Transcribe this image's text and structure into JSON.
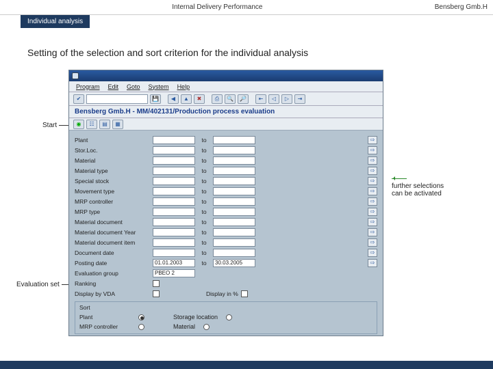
{
  "topbar": {
    "center": "Internal Delivery Performance",
    "right": "Bensberg Gmb.H"
  },
  "navtab": "Individual analysis",
  "section_title": "Setting of the selection and sort criterion for the individual analysis",
  "sap": {
    "menu": {
      "program": "Program",
      "edit": "Edit",
      "goto": "Goto",
      "system": "System",
      "help": "Help"
    },
    "heading": "Bensberg Gmb.H - MM/402131/Production process evaluation",
    "rows": [
      {
        "label": "Plant",
        "to": "to"
      },
      {
        "label": "Stor.Loc.",
        "to": "to"
      },
      {
        "label": "Material",
        "to": "to"
      },
      {
        "label": "Material type",
        "to": "to"
      },
      {
        "label": "Special stock",
        "to": "to"
      },
      {
        "label": "Movement type",
        "to": "to"
      },
      {
        "label": "MRP controller",
        "to": "to"
      },
      {
        "label": "MRP type",
        "to": "to"
      },
      {
        "label": "Material document",
        "to": "to"
      },
      {
        "label": "Material document Year",
        "to": "to"
      },
      {
        "label": "Material document item",
        "to": "to"
      },
      {
        "label": "Document date",
        "to": "to"
      }
    ],
    "posting": {
      "label": "Posting date",
      "from": "01.01.2003",
      "to_lbl": "to",
      "to": "30.03.2005"
    },
    "evalgroup": {
      "label": "Evaluation group",
      "value": "PBEO 2"
    },
    "ranking": {
      "label": "Ranking"
    },
    "display_vda": {
      "label": "Display by VDA",
      "pct": "Display in %"
    },
    "sort": {
      "title": "Sort",
      "r1": {
        "a": "Plant",
        "b": "Storage location"
      },
      "r2": {
        "a": "MRP controller",
        "b": "Material"
      }
    }
  },
  "annot": {
    "start": "Start",
    "evalset": "Evaluation set",
    "further": "further selections can be activated"
  }
}
